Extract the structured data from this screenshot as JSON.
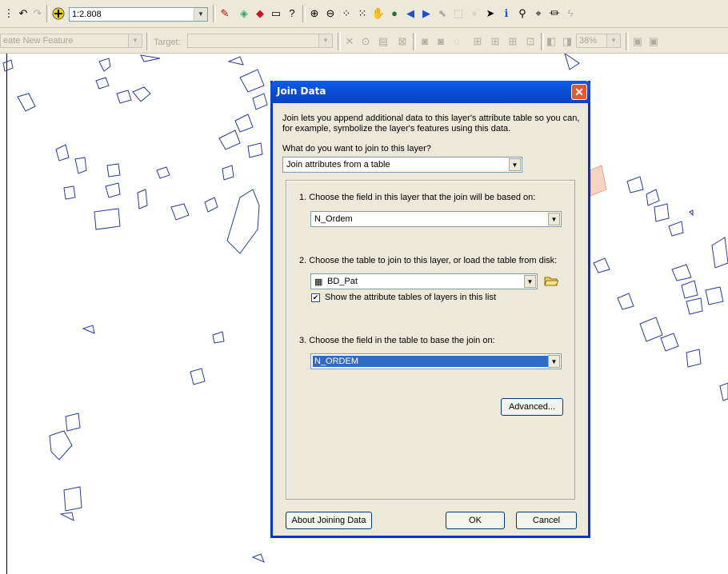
{
  "toolbar": {
    "scale_value": "1:2.808",
    "create_feature_text": "eate New Feature",
    "target_label": "Target:",
    "zoom_percent": "38%"
  },
  "dialog": {
    "title": "Join Data",
    "intro_line1": "Join lets you append additional data to this layer's attribute table so you can,",
    "intro_line2": "for example, symbolize the layer's features using this data.",
    "question": "What do you want to join to this layer?",
    "join_type_value": "Join attributes from a table",
    "step1_label": "1.  Choose the field in this layer that the join will be based on:",
    "step1_value": "N_Ordem",
    "step2_label": "2.  Choose the table to join to this layer, or load the table from disk:",
    "step2_value": "BD_Pat",
    "show_tables_label": "Show the attribute tables of layers in this list",
    "show_tables_checked": true,
    "step3_label": "3.  Choose the field in the table to base the join on:",
    "step3_value": "N_ORDEM",
    "advanced_button": "Advanced...",
    "about_button": "About Joining Data",
    "ok_button": "OK",
    "cancel_button": "Cancel"
  },
  "colors": {
    "title_bar": "#0b4fd6",
    "dialog_bg": "#ece9d8",
    "selection": "#316ac5",
    "map_features": "#2b3aa0",
    "highlight_feature": "#f7d4c4"
  }
}
